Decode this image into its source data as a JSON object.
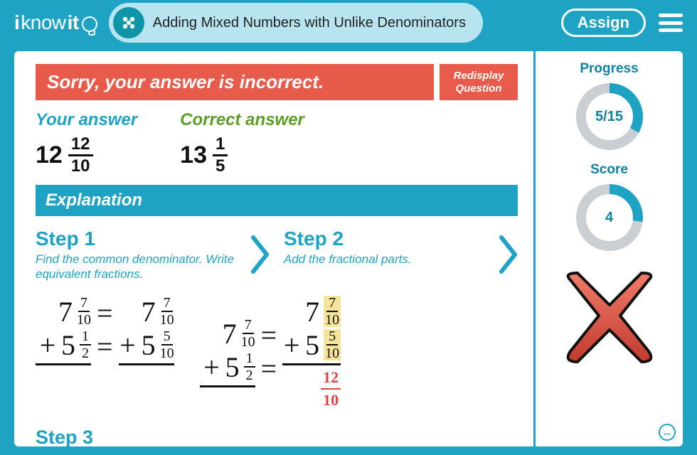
{
  "brand": {
    "i": "i",
    "know": "know",
    "it": "it"
  },
  "header": {
    "title": "Adding Mixed Numbers with Unlike Denominators",
    "assign": "Assign"
  },
  "banner": {
    "message": "Sorry, your answer is incorrect.",
    "redisplay_line1": "Redisplay",
    "redisplay_line2": "Question"
  },
  "answers": {
    "your_label": "Your answer",
    "your": {
      "whole": "12",
      "num": "12",
      "den": "10"
    },
    "correct_label": "Correct answer",
    "correct": {
      "whole": "13",
      "num": "1",
      "den": "5"
    }
  },
  "explanation": {
    "label": "Explanation",
    "step1": {
      "title": "Step 1",
      "desc": "Find the common denominator. Write equivalent fractions."
    },
    "step2": {
      "title": "Step 2",
      "desc": "Add the fractional parts."
    },
    "step3": {
      "title": "Step 3"
    }
  },
  "work": {
    "a_top": {
      "w": "7",
      "n": "7",
      "d": "10"
    },
    "a_top2": {
      "w": "7",
      "n": "7",
      "d": "10"
    },
    "a_bot": {
      "op": "+",
      "w": "5",
      "n": "1",
      "d": "2"
    },
    "a_bot2": {
      "op": "+",
      "w": "5",
      "n": "5",
      "d": "10"
    },
    "b_top": {
      "w": "7",
      "n": "7",
      "d": "10"
    },
    "b_top2": {
      "w": "7",
      "n": "7",
      "d": "10"
    },
    "b_bot": {
      "op": "+",
      "w": "5",
      "n": "1",
      "d": "2"
    },
    "b_bot2": {
      "op": "+",
      "w": "5",
      "n": "5",
      "d": "10"
    },
    "b_sum": {
      "n": "12",
      "d": "10"
    },
    "eq": "="
  },
  "sidebar": {
    "progress_label": "Progress",
    "progress_text": "5/15",
    "progress_pct": 33,
    "score_label": "Score",
    "score_text": "4",
    "score_pct": 27
  },
  "colors": {
    "brand": "#1fa3c4",
    "red": "#e85b4a",
    "green": "#5c9c28",
    "track": "#c9cfd2"
  }
}
